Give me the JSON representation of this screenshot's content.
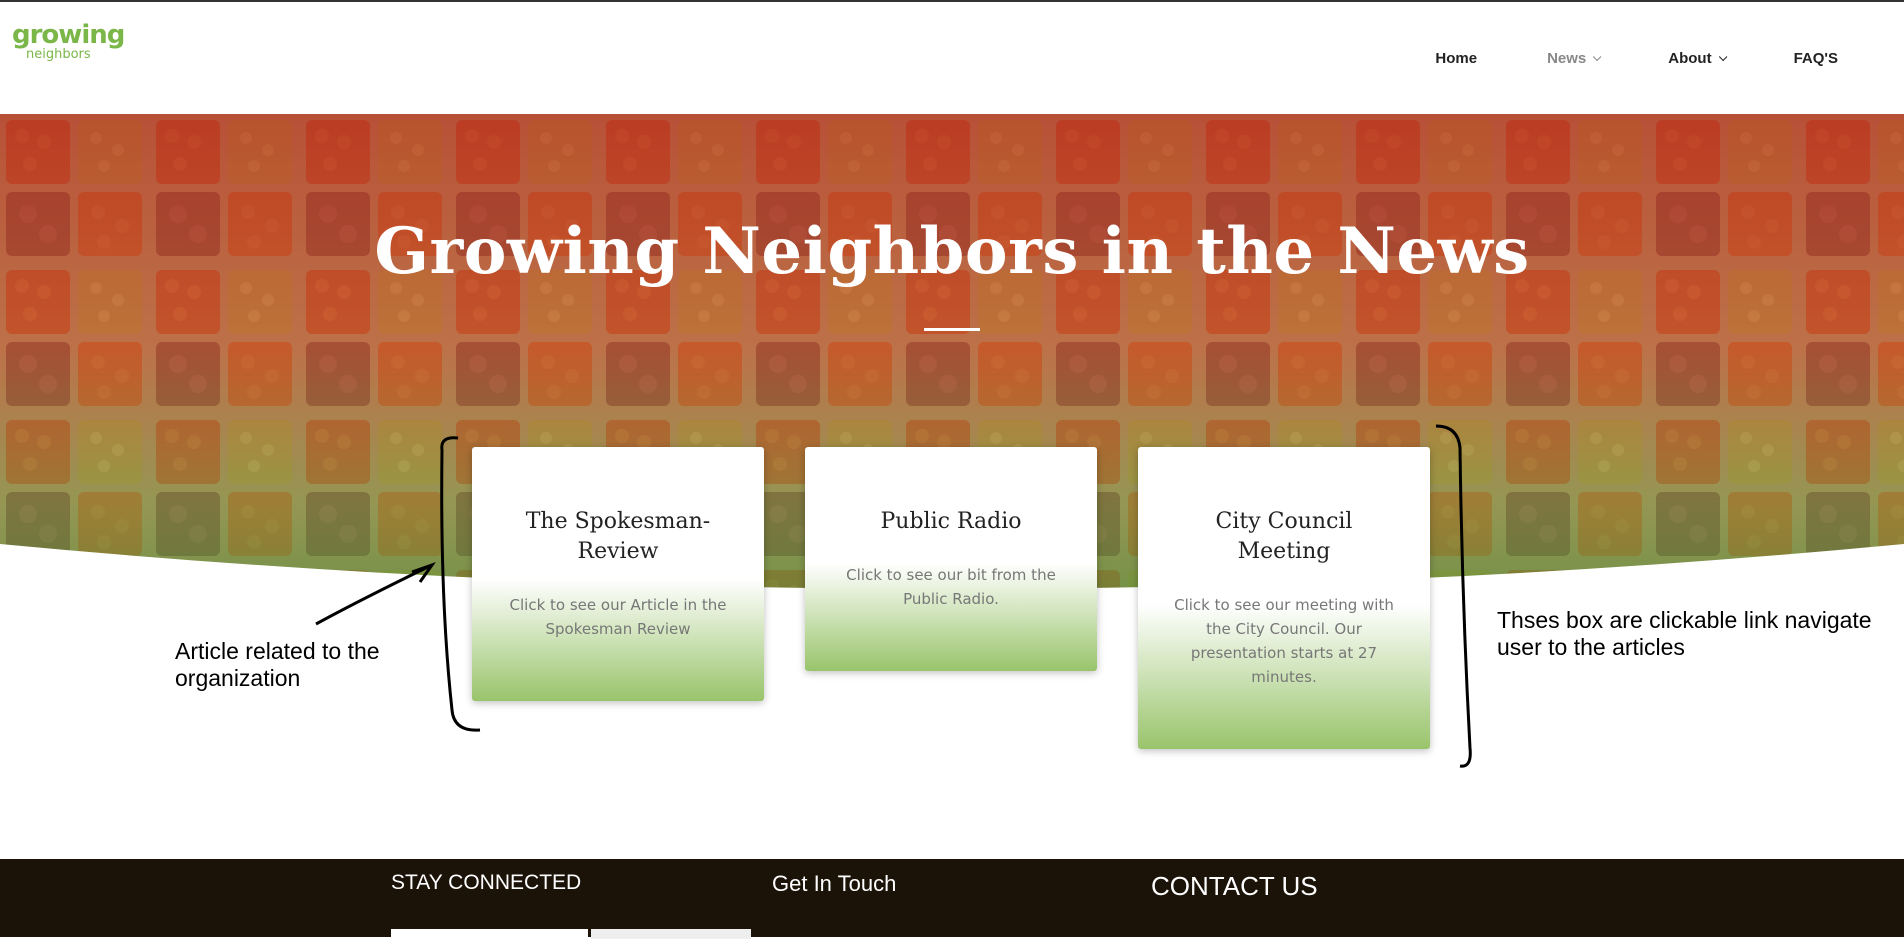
{
  "logo": {
    "line1": "growing",
    "line2": "neighbors"
  },
  "nav": {
    "home": "Home",
    "news": "News",
    "about": "About",
    "faqs": "FAQ'S"
  },
  "hero": {
    "title": "Growing Neighbors in the News"
  },
  "cards": [
    {
      "title": "The Spokesman-Review",
      "desc": "Click to see our Article in the Spokesman Review"
    },
    {
      "title": "Public Radio",
      "desc": "Click to see our bit from the Public Radio."
    },
    {
      "title": "City Council Meeting",
      "desc": "Click to see our meeting with the City Council. Our presentation starts at 27 minutes."
    }
  ],
  "annotations": {
    "left": "Article related to the organization",
    "right": "Thses box are clickable link navigate user to the articles"
  },
  "footer": {
    "stay_connected": "STAY CONNECTED",
    "get_in_touch": "Get In Touch",
    "contact_us": "CONTACT US"
  },
  "colors": {
    "brand_green": "#7ab648",
    "footer_bg": "#1b1208",
    "hero_overlay": "#b04025"
  }
}
